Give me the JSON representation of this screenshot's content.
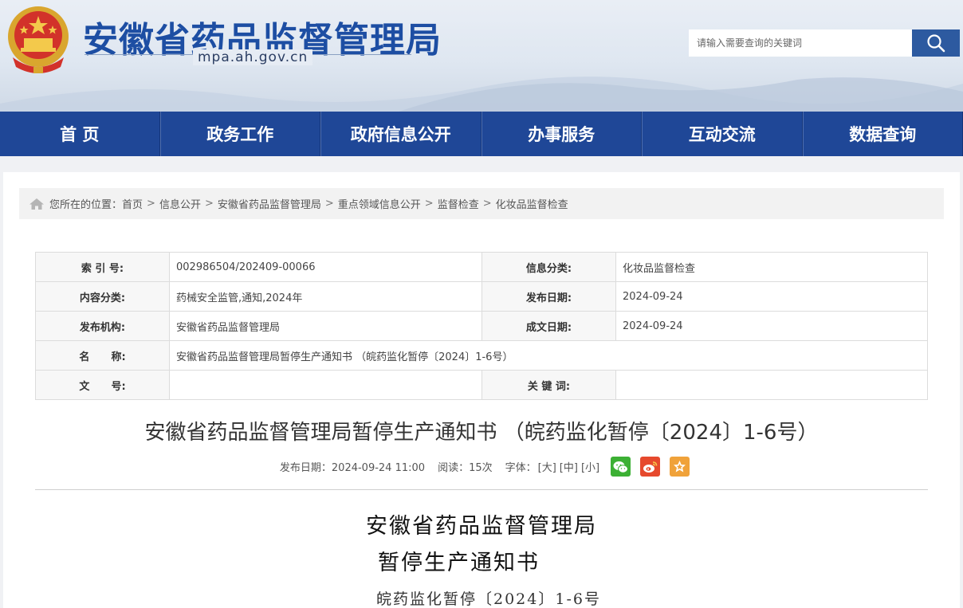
{
  "header": {
    "title": "安徽省药品监督管理局",
    "domain": "mpa.ah.gov.cn",
    "search_placeholder": "请输入需要查询的关键词"
  },
  "nav": [
    "首 页",
    "政务工作",
    "政府信息公开",
    "办事服务",
    "互动交流",
    "数据查询"
  ],
  "breadcrumb": {
    "prefix": "您所在的位置：",
    "items": [
      "首页",
      "信息公开",
      "安徽省药品监督管理局",
      "重点领域信息公开",
      "监督检查",
      "化妆品监督检查"
    ]
  },
  "meta": {
    "index_label": "索 引 号:",
    "index_value": "002986504/202409-00066",
    "info_cat_label": "信息分类:",
    "info_cat_value": "化妆品监督检查",
    "content_cat_label": "内容分类:",
    "content_cat_value": "药械安全监管,通知,2024年",
    "pub_date_label": "发布日期:",
    "pub_date_value": "2024-09-24",
    "org_label": "发布机构:",
    "org_value": "安徽省药品监督管理局",
    "doc_date_label": "成文日期:",
    "doc_date_value": "2024-09-24",
    "name_label": "名      称:",
    "name_value": "安徽省药品监督管理局暂停生产通知书 （皖药监化暂停〔2024〕1-6号）",
    "docno_label": "文      号:",
    "docno_value": "",
    "keywords_label": "关 键 词:",
    "keywords_value": ""
  },
  "article": {
    "title": "安徽省药品监督管理局暂停生产通知书 （皖药监化暂停〔2024〕1-6号）",
    "pub_time": "发布日期：2024-09-24 11:00",
    "reads": "阅读：15次",
    "font_label": "字体：",
    "font_large": "[大]",
    "font_medium": "[中]",
    "font_small": "[小]",
    "body_heading_1": "安徽省药品监督管理局",
    "body_heading_2": "暂停生产通知书",
    "body_docno": "皖药监化暂停〔2024〕1-6号"
  },
  "colors": {
    "nav_bg": "#1f4797",
    "title_blue": "#1d4ea3",
    "wechat": "#3cb034",
    "weibo": "#e6492d",
    "favorite": "#f0a23a"
  }
}
